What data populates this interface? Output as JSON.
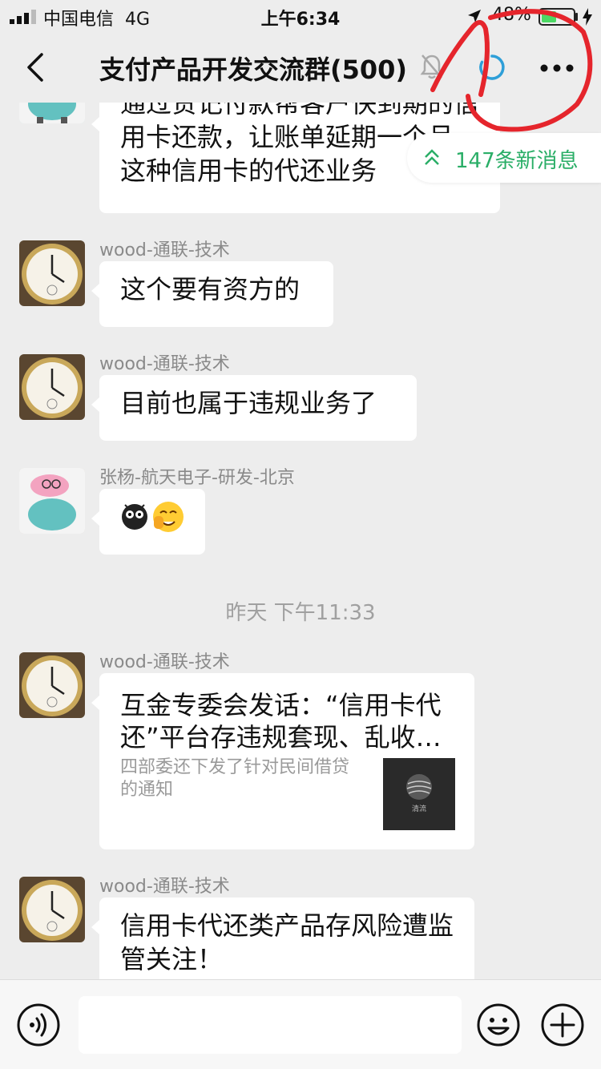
{
  "status_bar": {
    "carrier": "中国电信",
    "network": "4G",
    "time": "上午6:34",
    "battery": "48%",
    "battery_level": 0.48
  },
  "header": {
    "title": "支付产品开发交流群(500)"
  },
  "new_messages_badge": "147条新消息",
  "messages": [
    {
      "sender": "",
      "text": "通过贷记付款帮客户快到期的信用卡还款，让账单延期一个月，这种信用卡的代还业务"
    },
    {
      "sender": "wood-通联-技术",
      "text": "这个要有资方的"
    },
    {
      "sender": "wood-通联-技术",
      "text": "目前也属于违规业务了"
    },
    {
      "sender": "张杨-航天电子-研发-北京",
      "text": ""
    },
    {
      "sender": "wood-通联-技术",
      "link_title": "互金专委会发话：“信用卡代还”平台存违规套现、乱收…",
      "link_desc": "四部委还下发了针对民间借贷的通知",
      "thumb_label": "清流"
    },
    {
      "sender": "wood-通联-技术",
      "text": "信用卡代还类产品存风险遭监管关注！"
    }
  ],
  "timestamp": "昨天 下午11:33",
  "colors": {
    "background": "#ededed",
    "bubble": "#ffffff",
    "accent_green": "#2aae67",
    "annotation_red": "#e5252c"
  }
}
